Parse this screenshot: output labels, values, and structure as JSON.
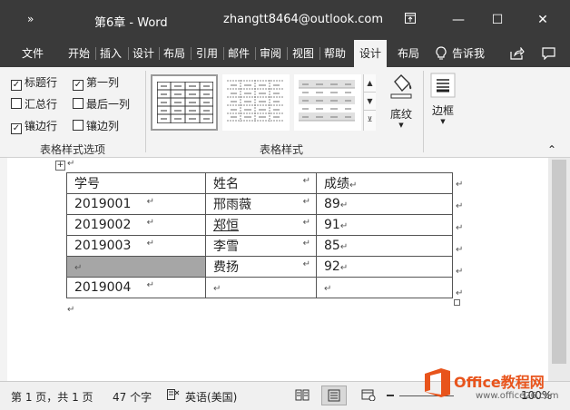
{
  "titlebar": {
    "qat": "»",
    "title": "第6章  -  Word",
    "account": "zhangtt8464@outlook.com",
    "restore_icon": "ribbon-display-icon",
    "min": "—",
    "max": "☐",
    "close": "✕"
  },
  "tabs": [
    "文件",
    "开始",
    "插入",
    "设计",
    "布局",
    "引用",
    "邮件",
    "审阅",
    "视图",
    "帮助",
    "设计",
    "布局"
  ],
  "active_tab": 10,
  "tell_me": "告诉我",
  "ribbon": {
    "options": [
      {
        "label": "标题行",
        "checked": true
      },
      {
        "label": "第一列",
        "checked": true
      },
      {
        "label": "汇总行",
        "checked": false
      },
      {
        "label": "最后一列",
        "checked": false
      },
      {
        "label": "镶边行",
        "checked": true
      },
      {
        "label": "镶边列",
        "checked": false
      }
    ],
    "options_group": "表格样式选项",
    "styles_group": "表格样式",
    "shading": "底纹",
    "borders": "边框"
  },
  "table": {
    "rows": [
      [
        "学号",
        "姓名",
        "成绩"
      ],
      [
        "2019001",
        "邢雨薇",
        "89"
      ],
      [
        "2019002",
        "郑恒",
        "91"
      ],
      [
        "2019003",
        "李雪",
        "85"
      ],
      [
        "",
        "费扬",
        "92"
      ],
      [
        "2019004",
        "",
        ""
      ]
    ]
  },
  "status": {
    "page": "第 1 页，共 1 页",
    "words": "47 个字",
    "lang": "英语(美国)",
    "zoom": "100%"
  },
  "watermark": {
    "brand": "Office教程网",
    "url": "www.office26.com"
  }
}
